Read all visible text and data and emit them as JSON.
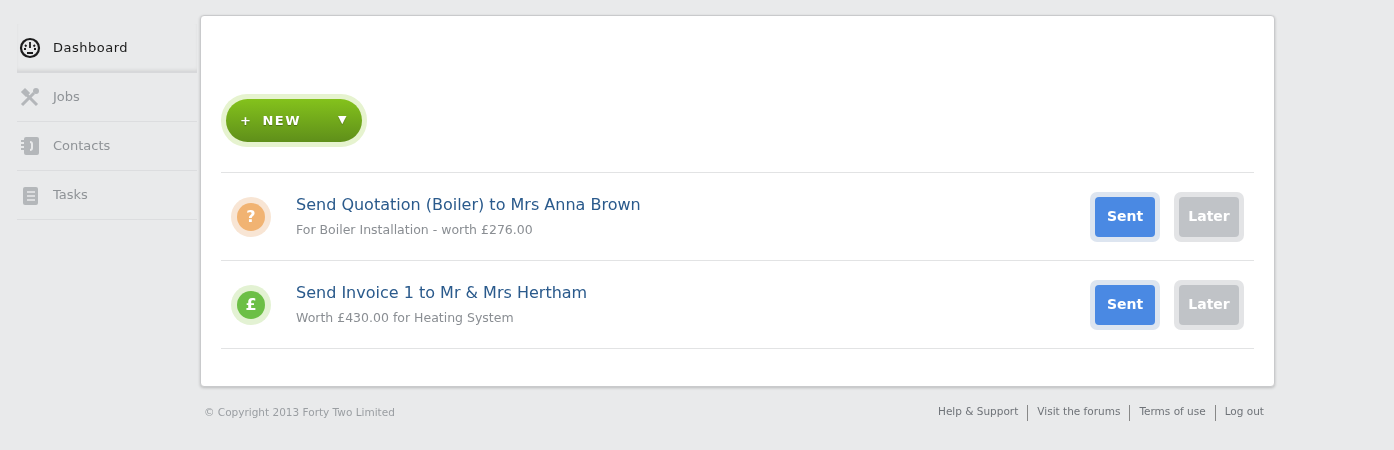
{
  "sidebar": {
    "items": [
      {
        "label": "Dashboard",
        "selected": true
      },
      {
        "label": "Jobs",
        "selected": false
      },
      {
        "label": "Contacts",
        "selected": false
      },
      {
        "label": "Tasks",
        "selected": false
      }
    ]
  },
  "new_button": {
    "plus": "+",
    "label": "NEW",
    "caret": "▼"
  },
  "tasks": [
    {
      "kind": "quote",
      "badge": "?",
      "title": "Send Quotation (Boiler) to Mrs Anna Brown",
      "subtitle": "For Boiler Installation - worth £276.00",
      "buttons": [
        {
          "label": "Sent",
          "kind": "primary"
        },
        {
          "label": "Later",
          "kind": "secondary"
        }
      ]
    },
    {
      "kind": "invoice",
      "badge": "£",
      "title": "Send Invoice 1 to Mr & Mrs Hertham",
      "subtitle": "Worth £430.00 for Heating System",
      "buttons": [
        {
          "label": "Sent",
          "kind": "primary"
        },
        {
          "label": "Later",
          "kind": "secondary"
        }
      ]
    }
  ],
  "footer": {
    "copyright": "© Copyright 2013 Forty Two Limited",
    "links": [
      "Help & Support",
      "Visit the forums",
      "Terms of use",
      "Log out"
    ]
  }
}
